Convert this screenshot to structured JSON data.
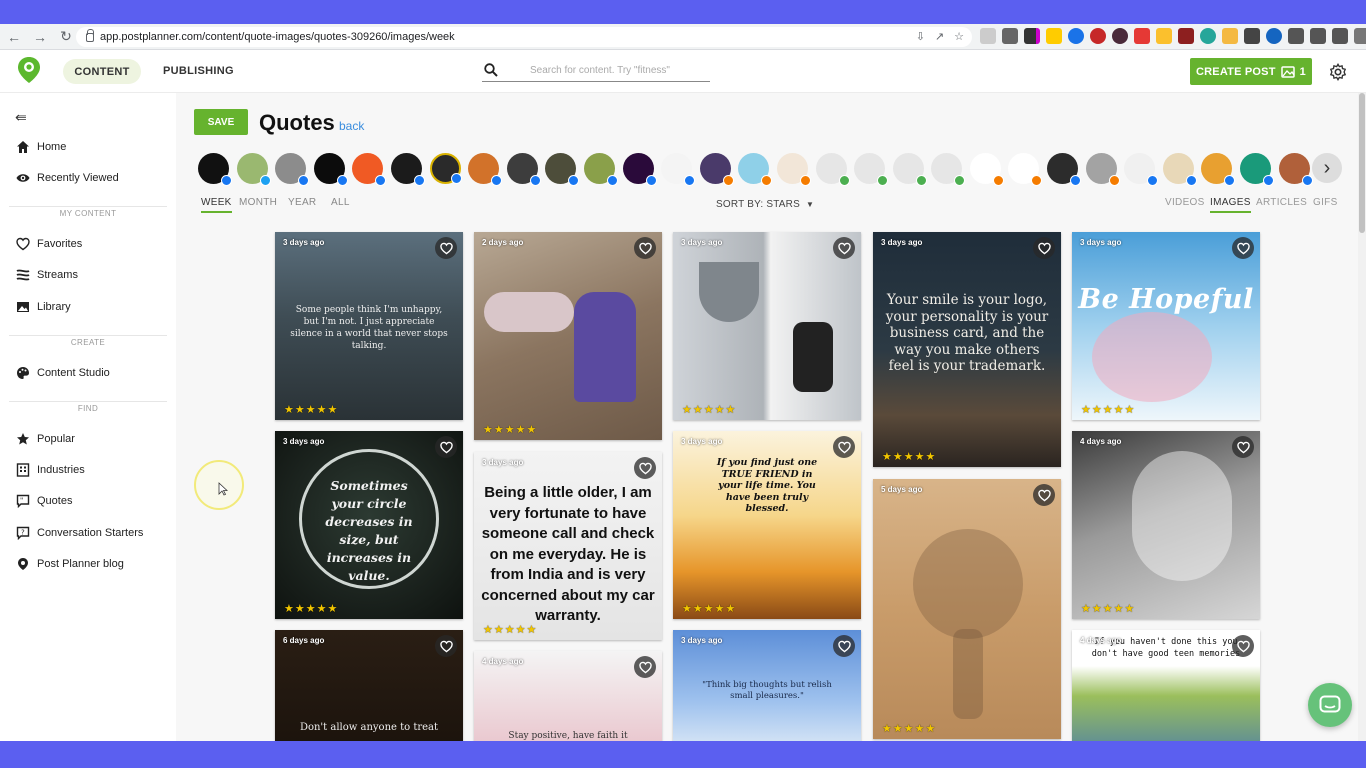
{
  "browser": {
    "url": "app.postplanner.com/content/quote-images/quotes-309260/images/week"
  },
  "header": {
    "nav_content": "CONTENT",
    "nav_publishing": "PUBLISHING",
    "search_placeholder": "Search for content. Try \"fitness\"",
    "create_post_label": "CREATE POST",
    "create_post_count": "1"
  },
  "sidebar": {
    "items_top": [
      {
        "label": "Home",
        "icon": "home-icon"
      },
      {
        "label": "Recently Viewed",
        "icon": "eye-icon"
      }
    ],
    "my_content_heading": "MY CONTENT",
    "my_content": [
      {
        "label": "Favorites",
        "icon": "heart-icon"
      },
      {
        "label": "Streams",
        "icon": "streams-icon"
      },
      {
        "label": "Library",
        "icon": "library-icon"
      }
    ],
    "create_heading": "CREATE",
    "create": [
      {
        "label": "Content Studio",
        "icon": "palette-icon"
      }
    ],
    "find_heading": "FIND",
    "find": [
      {
        "label": "Popular",
        "icon": "star-icon"
      },
      {
        "label": "Industries",
        "icon": "building-icon"
      },
      {
        "label": "Quotes",
        "icon": "quote-bubble-icon"
      },
      {
        "label": "Conversation Starters",
        "icon": "question-bubble-icon"
      },
      {
        "label": "Post Planner blog",
        "icon": "postplanner-icon"
      }
    ]
  },
  "main": {
    "save_label": "SAVE",
    "title": "Quotes",
    "back_label": "back",
    "periods": [
      "WEEK",
      "MONTH",
      "YEAR",
      "ALL"
    ],
    "active_period": "WEEK",
    "sort_label": "SORT BY: STARS",
    "content_types": [
      "VIDEOS",
      "IMAGES",
      "ARTICLES",
      "GIFS"
    ],
    "active_type": "IMAGES",
    "stars": "★★★★★",
    "cards": [
      {
        "age": "3 days ago",
        "text": "Some people think I'm unhappy, but I'm not. I just appreciate silence in a world that never stops talking."
      },
      {
        "age": "2 days ago",
        "text": ""
      },
      {
        "age": "3 days ago",
        "text": ""
      },
      {
        "age": "3 days ago",
        "text": "Your smile is your logo, your personality is your business card, and the way you make others feel is your trademark."
      },
      {
        "age": "3 days ago",
        "text": "Be Hopeful"
      },
      {
        "age": "3 days ago",
        "text": "Sometimes your circle decreases in size, but increases in value."
      },
      {
        "age": "3 days ago",
        "text": "Being a little older, I am very fortunate to have someone call and check on me everyday. He is from India and is very concerned about my car warranty."
      },
      {
        "age": "3 days ago",
        "text": "If you find just one TRUE FRIEND in your life time. You have been truly blessed."
      },
      {
        "age": "5 days ago",
        "text": ""
      },
      {
        "age": "4 days ago",
        "text": ""
      },
      {
        "age": "6 days ago",
        "text": "Don't allow anyone to treat"
      },
      {
        "age": "4 days ago",
        "text": "Stay positive, have faith it"
      },
      {
        "age": "3 days ago",
        "text": "\"Think big thoughts but relish small pleasures.\""
      },
      {
        "age": "4 days ago",
        "text": "If you haven't done this you don't have good teen memories"
      }
    ]
  }
}
